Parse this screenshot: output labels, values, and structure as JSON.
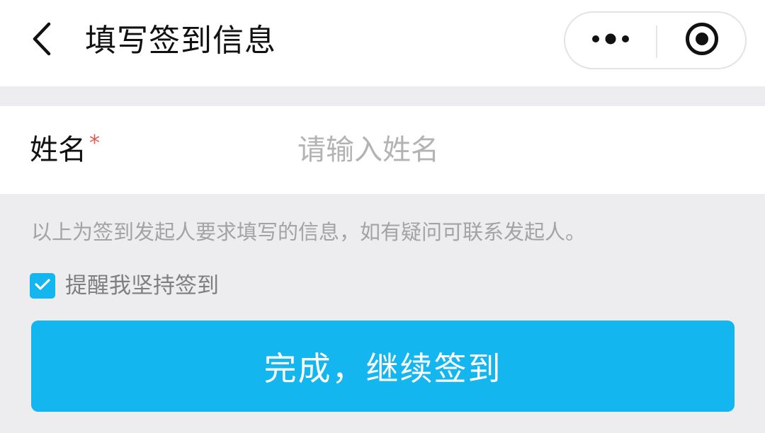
{
  "colors": {
    "accent": "#14b6ef",
    "required": "#e25a4d",
    "background": "#ededf0"
  },
  "header": {
    "back_icon": "chevron-left-icon",
    "title": "填写签到信息",
    "capsule": {
      "more_icon": "more-dots-icon",
      "close_icon": "target-circle-icon"
    }
  },
  "form": {
    "name": {
      "label": "姓名",
      "required_mark": "*",
      "value": "",
      "placeholder": "请输入姓名"
    }
  },
  "hint": "以上为签到发起人要求填写的信息，如有疑问可联系发起人。",
  "remind": {
    "checked": true,
    "label": "提醒我坚持签到"
  },
  "submit": {
    "label": "完成，继续签到"
  }
}
